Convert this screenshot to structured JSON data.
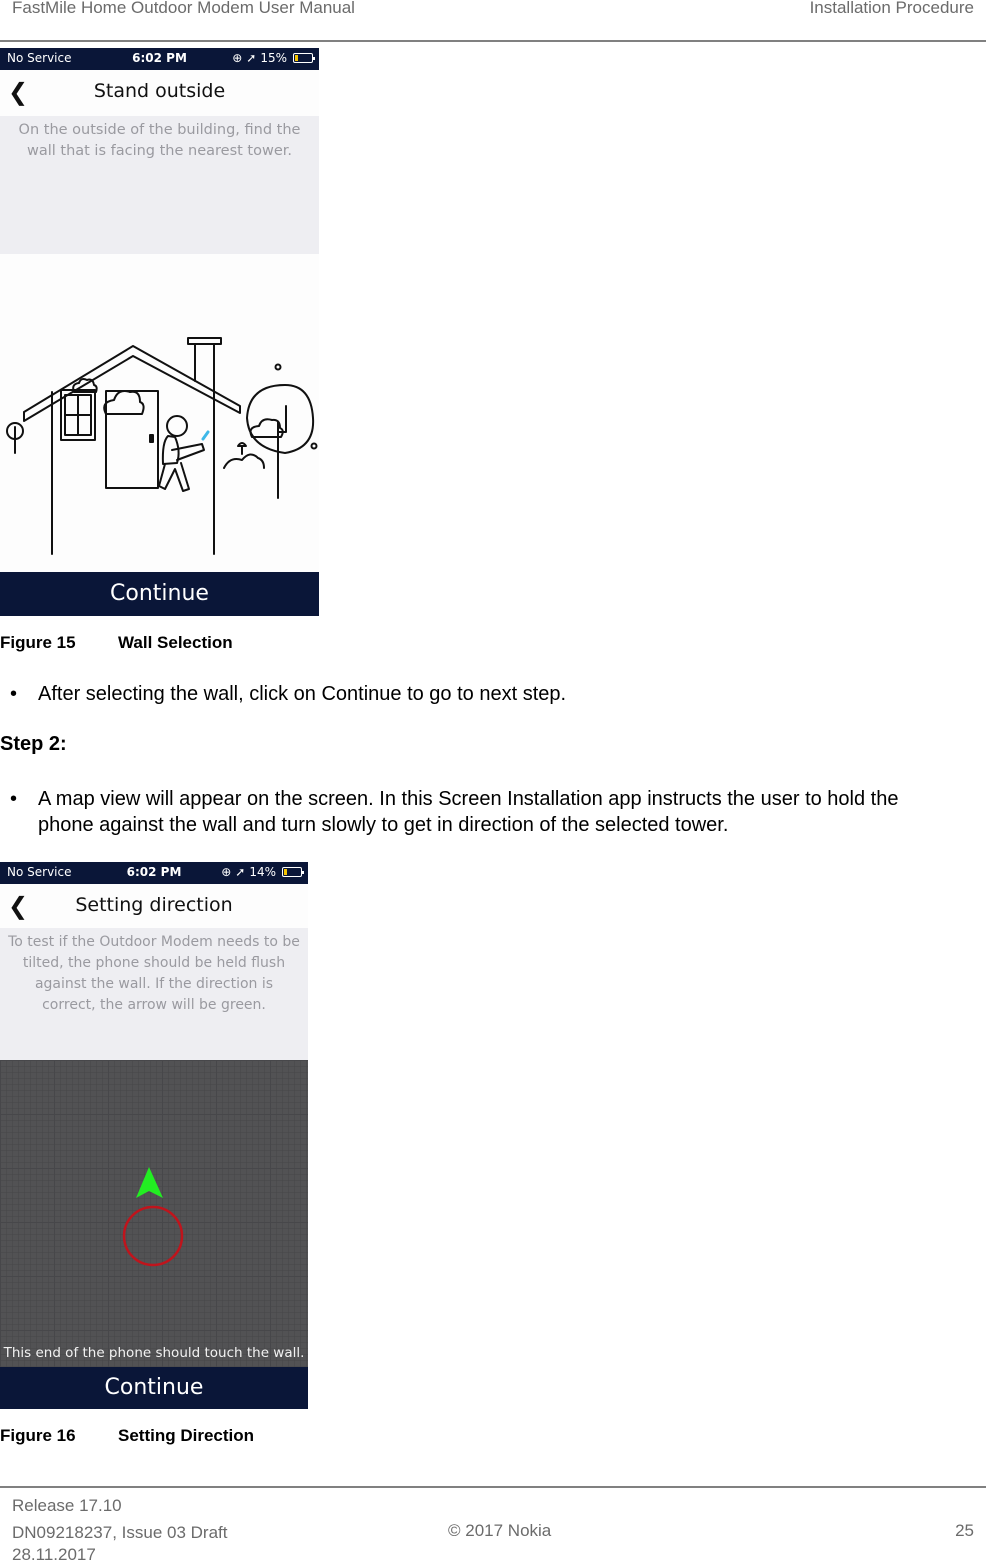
{
  "header": {
    "doc_title": "FastMile Home Outdoor Modem User Manual",
    "section": "Installation Procedure"
  },
  "figure15": {
    "status_bar": {
      "carrier": "No Service",
      "time": "6:02 PM",
      "battery": "15%",
      "battery_level": 0.15,
      "icons": [
        "rotation-lock-icon",
        "location-arrow-icon",
        "battery-icon"
      ]
    },
    "nav": {
      "back_icon": "chevron-left-icon",
      "title": "Stand outside"
    },
    "instruction": "On the outside of the building, find the wall that is facing the nearest tower.",
    "illustration": "house-with-person-holding-phone",
    "continue_label": "Continue",
    "caption_number": "Figure 15",
    "caption_title": "Wall Selection"
  },
  "body": {
    "bullet1": "After selecting the wall, click on Continue to go to next step.",
    "step2_heading": "Step 2:",
    "bullet2": "A map view will appear on the screen. In this Screen Installation app instructs the user to hold the phone against the wall and turn slowly to get in direction of the selected tower.",
    "bullet_glyph": "•"
  },
  "figure16": {
    "status_bar": {
      "carrier": "No Service",
      "time": "6:02 PM",
      "battery": "14%",
      "battery_level": 0.14
    },
    "nav": {
      "back_icon": "chevron-left-icon",
      "title": "Setting direction"
    },
    "instruction": "To test if the Outdoor Modem needs to be tilted, the phone should be held flush against the wall. If the direction is correct, the arrow will be green.",
    "arrow_color": "#22ee22",
    "circle_color": "#c0141c",
    "touch_hint": "This end of the phone should touch the wall.",
    "continue_label": "Continue",
    "caption_number": "Figure 16",
    "caption_title": "Setting Direction"
  },
  "footer": {
    "release": "Release 17.10",
    "doc_id": "DN09218237, Issue 03 Draft",
    "date": "28.11.2017",
    "copyright": "© 2017 Nokia",
    "page_number": "25"
  },
  "colors": {
    "app_navy": "#0a1638",
    "instruction_bg": "#eeeef2",
    "instruction_text": "#9a9aa0",
    "header_gray": "#6b6b6b"
  }
}
